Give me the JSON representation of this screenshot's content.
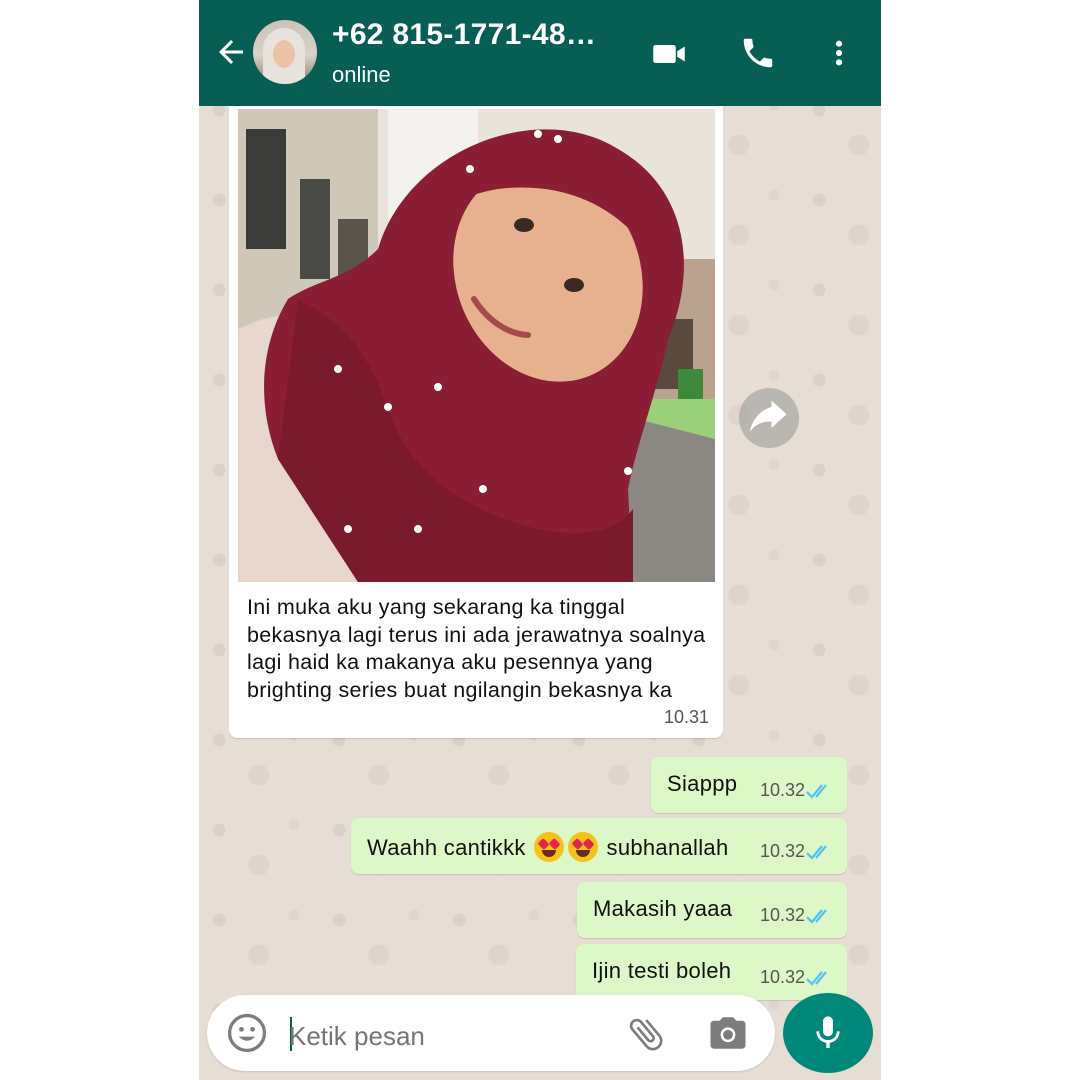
{
  "header": {
    "contact_name": "+62 815-1771-48…",
    "status": "online"
  },
  "messages": {
    "image_caption": "Ini muka aku yang sekarang ka tinggal bekasnya lagi terus ini ada jerawatnya soalnya lagi haid ka makanya aku pesennya yang brighting series buat ngilangin bekasnya ka",
    "image_time": "10.31",
    "outgoing": [
      {
        "text": "Siappp",
        "time": "10.32"
      },
      {
        "text_before": "Waahh cantikkk",
        "text_after": "subhanallah",
        "time": "10.32"
      },
      {
        "text": "Makasih yaaa",
        "time": "10.32"
      },
      {
        "text": "Ijin testi boleh",
        "time": "10.32"
      }
    ]
  },
  "input": {
    "placeholder": "Ketik pesan"
  },
  "icons": {
    "back": "arrow-left",
    "video": "video-camera",
    "call": "phone",
    "menu": "more-vertical",
    "forward": "forward-arrow",
    "emoji": "smiley",
    "attach": "paperclip",
    "camera": "camera",
    "mic": "microphone",
    "read_ticks": "double-check-blue"
  },
  "colors": {
    "header": "#075e54",
    "outgoing_bubble": "#dcf8c6",
    "incoming_bubble": "#ffffff",
    "wallpaper": "#e6ddd4",
    "read_ticks": "#4fc3f7",
    "mic_button": "#00897b"
  }
}
